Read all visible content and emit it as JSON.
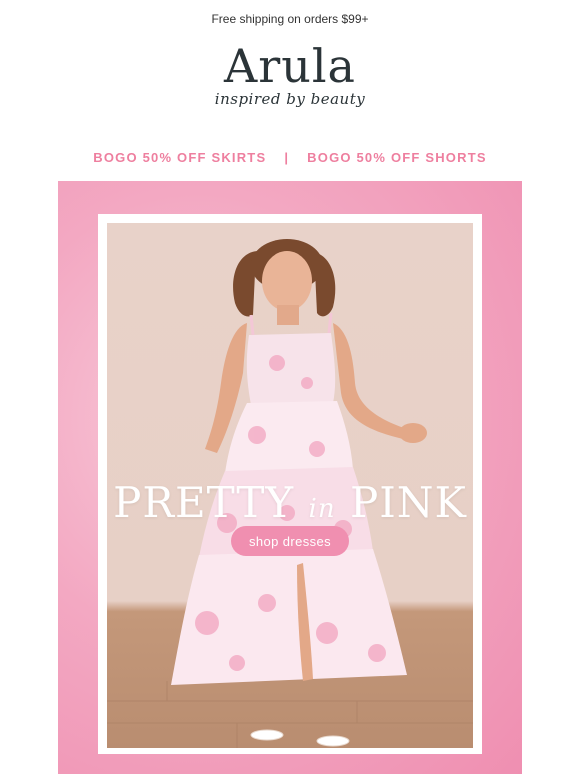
{
  "topbar": {
    "text": "Free shipping on orders $99+"
  },
  "brand": {
    "name": "Arula",
    "tagline": "inspired by beauty"
  },
  "promo": {
    "left": "BOGO 50% OFF SKIRTS",
    "separator": "|",
    "right": "BOGO 50% OFF SHORTS"
  },
  "hero": {
    "headline_part1": "PRETTY",
    "headline_part2": "in",
    "headline_part3": "PINK",
    "cta_label": "shop dresses"
  },
  "colors": {
    "accent_pink": "#ee7f9f",
    "cta_pink": "#f08fb0",
    "logo_dark": "#2b3438"
  }
}
